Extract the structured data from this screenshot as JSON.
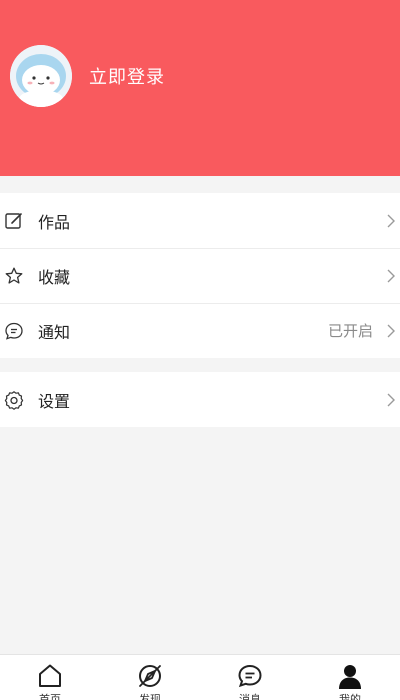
{
  "header": {
    "login_text": "立即登录",
    "avatar_icon": "cartoon-avatar"
  },
  "menu": {
    "group1": [
      {
        "label": "作品",
        "icon": "edit-icon",
        "value": ""
      },
      {
        "label": "收藏",
        "icon": "star-icon",
        "value": ""
      },
      {
        "label": "通知",
        "icon": "message-icon",
        "value": "已开启"
      }
    ],
    "group2": [
      {
        "label": "设置",
        "icon": "gear-icon",
        "value": ""
      }
    ]
  },
  "tabbar": {
    "items": [
      {
        "label": "首页",
        "icon": "home-icon",
        "active": false
      },
      {
        "label": "发现",
        "icon": "compass-icon",
        "active": false
      },
      {
        "label": "消息",
        "icon": "chat-icon",
        "active": false
      },
      {
        "label": "我的",
        "icon": "user-icon",
        "active": true
      }
    ]
  },
  "colors": {
    "header_bg": "#f95a5e",
    "page_bg": "#f4f4f4",
    "text_primary": "#222222",
    "text_secondary": "#8a8a8a"
  }
}
